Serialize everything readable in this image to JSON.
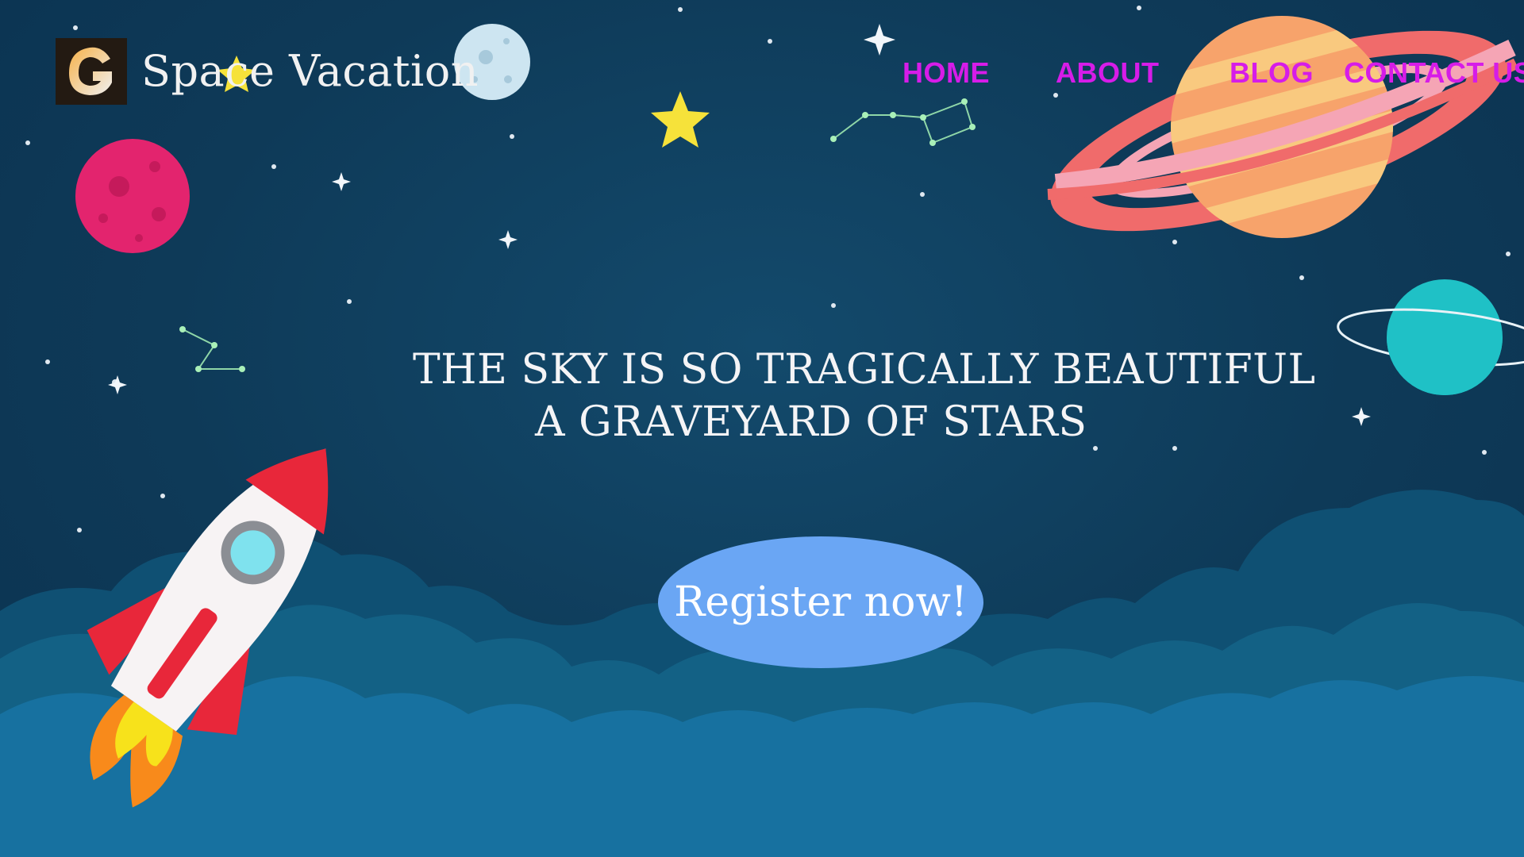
{
  "brand": {
    "logo_letter": "G",
    "name": "Space Vacation"
  },
  "nav": {
    "items": [
      {
        "label": "HOME"
      },
      {
        "label": "ABOUT"
      },
      {
        "label": "BLOG"
      },
      {
        "label": "CONTACT US"
      }
    ]
  },
  "hero": {
    "line1": "THE SKY IS SO TRAGICALLY BEAUTIFUL",
    "line2": "A GRAVEYARD OF STARS",
    "cta_label": "Register now!"
  },
  "colors": {
    "background": "#0f3c5a",
    "nav_link": "#d61ce8",
    "cta": "#6aa6f4",
    "text": "#f4f4f6"
  },
  "icons": [
    "logo-icon",
    "rocket-illustration",
    "saturn-planet",
    "cyan-planet",
    "pink-planet",
    "moon",
    "star",
    "constellation",
    "cloud"
  ]
}
